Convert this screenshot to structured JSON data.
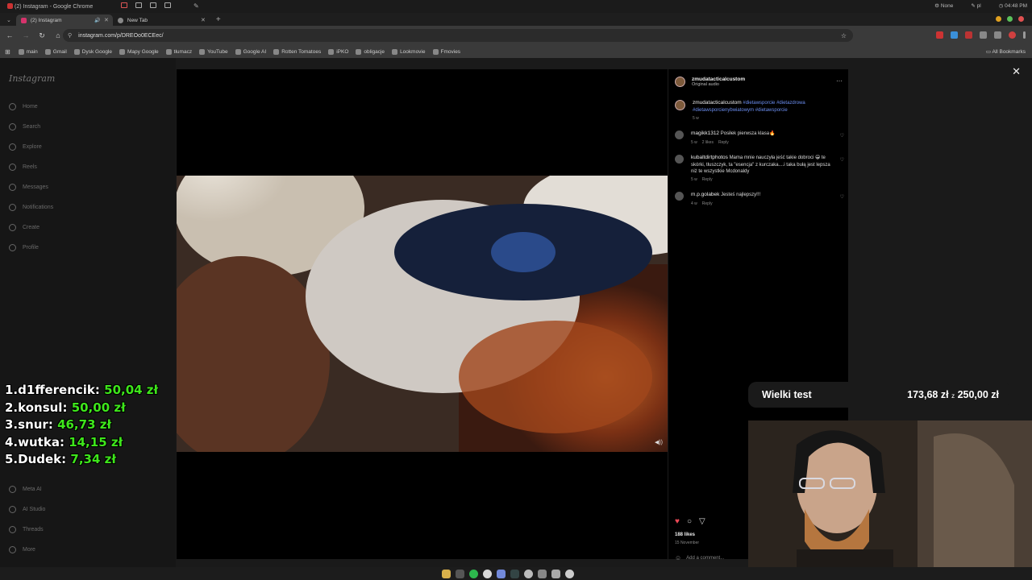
{
  "os_bar": {
    "window_title": "(2) Instagram - Google Chrome",
    "status_item": "None",
    "language": "pl",
    "clock": "04:48 PM"
  },
  "tabs": [
    {
      "label": "(2) Instagram",
      "active": true
    },
    {
      "label": "New Tab",
      "active": false
    }
  ],
  "address_bar": {
    "url": "instagram.com/p/DREOo0ECEec/"
  },
  "bookmarks": [
    {
      "label": "main",
      "icon": "folder-icon"
    },
    {
      "label": "Gmail",
      "icon": "gmail-icon"
    },
    {
      "label": "Dysk Google",
      "icon": "drive-icon"
    },
    {
      "label": "Mapy Google",
      "icon": "maps-icon"
    },
    {
      "label": "tłumacz",
      "icon": "translate-icon"
    },
    {
      "label": "YouTube",
      "icon": "youtube-icon"
    },
    {
      "label": "Google AI",
      "icon": "google-ai-icon"
    },
    {
      "label": "Rotten Tomatoes",
      "icon": "tomato-icon"
    },
    {
      "label": "iPKO",
      "icon": "bank-icon"
    },
    {
      "label": "obligacje",
      "icon": "doc-icon"
    },
    {
      "label": "Lookmovie",
      "icon": "movie-icon"
    },
    {
      "label": "Fmovies",
      "icon": "film-icon"
    }
  ],
  "bookmarks_all": "All Bookmarks",
  "sidebar": {
    "logo": "Instagram",
    "items": [
      {
        "label": "Home"
      },
      {
        "label": "Search"
      },
      {
        "label": "Explore"
      },
      {
        "label": "Reels"
      },
      {
        "label": "Messages"
      },
      {
        "label": "Notifications"
      },
      {
        "label": "Create"
      },
      {
        "label": "Profile"
      }
    ],
    "bottom_items": [
      {
        "label": "Meta AI"
      },
      {
        "label": "AI Studio"
      },
      {
        "label": "Threads"
      },
      {
        "label": "More"
      }
    ]
  },
  "post": {
    "author": "zmudatacticalcustom",
    "audio": "Original audio",
    "caption_author": "zmudatacticalcustom",
    "caption_tags": "#dietawsporcie #dietazdrowa #dietawsporcienybwiatowym #dietawsporcie",
    "caption_age": "5 w",
    "comments": [
      {
        "user": "magikk1312",
        "text": "Posiłek pierwsza klasa🔥",
        "age": "5 w",
        "likes": "2 likes",
        "reply": "Reply"
      },
      {
        "user": "kubaltdirtphotos",
        "text": "Mama mnie nauczyła jeść takie dobroci 😁 te skórki, tłuszczyk, ta \"esencja\" z kurczaka....i taka bułą jest lepsza niż te wszystkie Mcdonaldy",
        "age": "5 w",
        "likes": "",
        "reply": "Reply"
      },
      {
        "user": "m.p.golabek",
        "text": "Jesteś najlepszy!!!",
        "age": "4 w",
        "likes": "",
        "reply": "Reply"
      }
    ],
    "likes": "188 likes",
    "date": "15 November",
    "add_comment_placeholder": "Add a comment..."
  },
  "leaderboard": [
    {
      "rank": "1.",
      "name": "d1fferencik:",
      "amount": "50,04 zł"
    },
    {
      "rank": "2.",
      "name": "konsul:",
      "amount": "50,00 zł"
    },
    {
      "rank": "3.",
      "name": "snur:",
      "amount": "46,73 zł"
    },
    {
      "rank": "4.",
      "name": "wutka:",
      "amount": "14,15 zł"
    },
    {
      "rank": "5.",
      "name": "Dudek:",
      "amount": "7,34 zł"
    }
  ],
  "goal": {
    "name": "Wielki test",
    "current": "173,68 zł",
    "separator": "z",
    "target": "250,00 zł"
  },
  "colors": {
    "leaderboard_amount": "#3ee61b",
    "hashtag_link": "#6b8ef0",
    "like_heart": "#ed4956"
  }
}
